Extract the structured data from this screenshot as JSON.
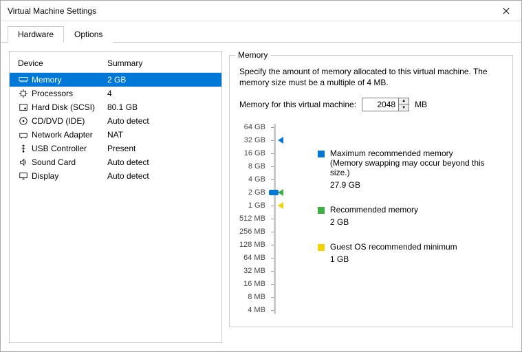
{
  "window": {
    "title": "Virtual Machine Settings"
  },
  "tabs": {
    "hardware": "Hardware",
    "options": "Options"
  },
  "columns": {
    "device": "Device",
    "summary": "Summary"
  },
  "devices": [
    {
      "icon": "memory-icon",
      "name": "Memory",
      "summary": "2 GB",
      "selected": true
    },
    {
      "icon": "cpu-icon",
      "name": "Processors",
      "summary": "4",
      "selected": false
    },
    {
      "icon": "disk-icon",
      "name": "Hard Disk (SCSI)",
      "summary": "80.1 GB",
      "selected": false
    },
    {
      "icon": "cd-icon",
      "name": "CD/DVD (IDE)",
      "summary": "Auto detect",
      "selected": false
    },
    {
      "icon": "network-icon",
      "name": "Network Adapter",
      "summary": "NAT",
      "selected": false
    },
    {
      "icon": "usb-icon",
      "name": "USB Controller",
      "summary": "Present",
      "selected": false
    },
    {
      "icon": "sound-icon",
      "name": "Sound Card",
      "summary": "Auto detect",
      "selected": false
    },
    {
      "icon": "display-icon",
      "name": "Display",
      "summary": "Auto detect",
      "selected": false
    }
  ],
  "memory": {
    "group_title": "Memory",
    "description": "Specify the amount of memory allocated to this virtual machine. The memory size must be a multiple of 4 MB.",
    "field_label": "Memory for this virtual machine:",
    "value": "2048",
    "unit": "MB",
    "ticks": [
      "64 GB",
      "32 GB",
      "16 GB",
      "8 GB",
      "4 GB",
      "2 GB",
      "1 GB",
      "512 MB",
      "256 MB",
      "128 MB",
      "64 MB",
      "32 MB",
      "16 MB",
      "8 MB",
      "4 MB"
    ],
    "markers": {
      "blue_idx": 1,
      "green_idx": 5,
      "yellow_idx": 6,
      "thumb_idx": 5
    },
    "legend": {
      "max": {
        "label": "Maximum recommended memory",
        "note": "(Memory swapping may occur beyond this size.)",
        "value": "27.9 GB"
      },
      "rec": {
        "label": "Recommended memory",
        "value": "2 GB"
      },
      "guest": {
        "label": "Guest OS recommended minimum",
        "value": "1 GB"
      }
    }
  }
}
